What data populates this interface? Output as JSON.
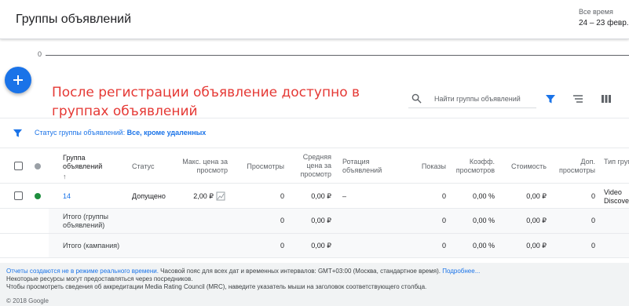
{
  "header": {
    "title": "Группы объявлений",
    "date_label": "Все время",
    "date_range": "24 – 23 февр."
  },
  "chart": {
    "zero_label": "0"
  },
  "annotation": "После регистрации объявление доступно в группах объявлений",
  "search": {
    "placeholder": "Найти группы объявлений"
  },
  "filter": {
    "label": "Статус группы объявлений:",
    "value": "Все, кроме удаленных"
  },
  "table": {
    "columns": {
      "group": "Группа объявлений",
      "sort_arrow": "↑",
      "status": "Статус",
      "max_cpv": "Макс. цена за просмотр",
      "views": "Просмотры",
      "avg_cpv": "Средняя цена за просмотр",
      "rotation": "Ротация объявлений",
      "impressions": "Показы",
      "view_rate": "Коэфф. просмотров",
      "cost": "Стоимость",
      "more_views": "Доп. просмотры",
      "type": "Тип группы"
    },
    "rows": [
      {
        "group": "14",
        "status": "Допущено",
        "max_cpv": "2,00 ₽",
        "views": "0",
        "avg_cpv": "0,00 ₽",
        "rotation": "–",
        "impressions": "0",
        "view_rate": "0,00 %",
        "cost": "0,00 ₽",
        "more_views": "0",
        "type": "Video Discovery"
      }
    ],
    "totals": [
      {
        "label": "Итого (группы объявлений)",
        "views": "0",
        "avg_cpv": "0,00 ₽",
        "impressions": "0",
        "view_rate": "0,00 %",
        "cost": "0,00 ₽",
        "more_views": "0"
      },
      {
        "label": "Итого (кампания)",
        "views": "0",
        "avg_cpv": "0,00 ₽",
        "impressions": "0",
        "view_rate": "0,00 %",
        "cost": "0,00 ₽",
        "more_views": "0"
      }
    ]
  },
  "footer": {
    "realtime_link": "Отчеты создаются не в режиме реального времени.",
    "timezone_text": "Часовой пояс для всех дат и временных интервалов: GMT+03:00 (Москва, стандартное время).",
    "more_link": "Подробнее...",
    "line2": "Некоторые ресурсы могут предоставляться через посредников.",
    "line3": "Чтобы просмотреть сведения об аккредитации Media Rating Council (MRC), наведите указатель мыши на заголовок соответствующего столбца.",
    "copyright": "© 2018 Google"
  },
  "colors": {
    "accent": "#1a73e8",
    "status_green": "#1e8e3e",
    "annotation_red": "#e53935"
  },
  "icons": [
    "plus-icon",
    "search-icon",
    "filter-icon",
    "segment-icon",
    "columns-icon",
    "chart-icon"
  ]
}
